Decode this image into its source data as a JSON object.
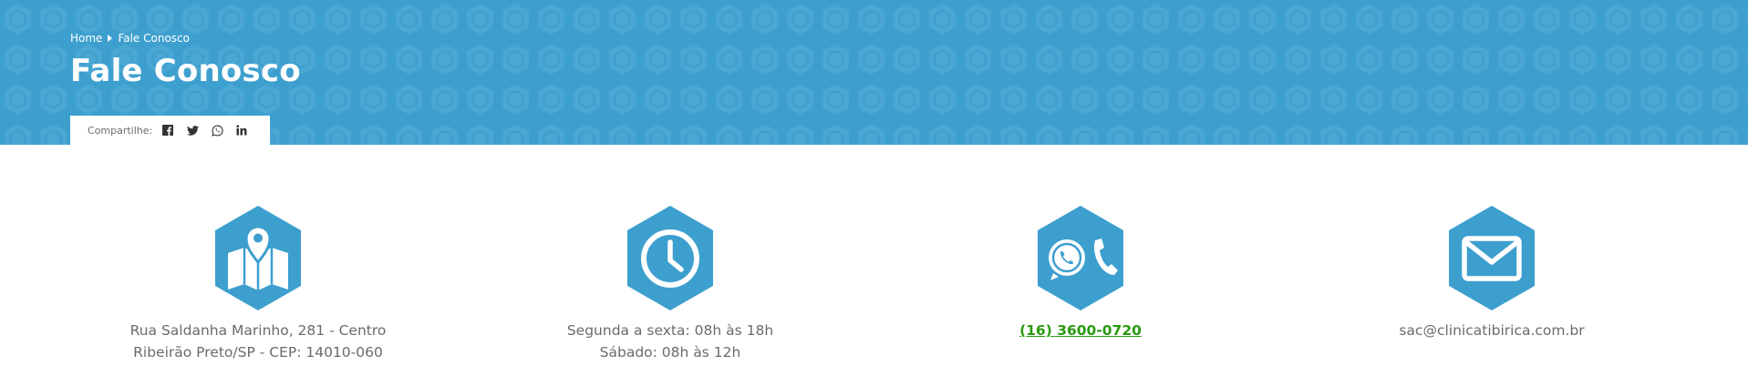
{
  "breadcrumb": {
    "home": "Home",
    "current": "Fale Conosco"
  },
  "page": {
    "title": "Fale Conosco"
  },
  "share": {
    "label": "Compartilhe:",
    "networks": [
      "facebook-icon",
      "twitter-icon",
      "whatsapp-icon",
      "linkedin-icon"
    ]
  },
  "contacts": {
    "address": {
      "icon": "map-pin-icon",
      "line1": "Rua Saldanha Marinho, 281 - Centro",
      "line2": "Ribeirão Preto/SP - CEP: 14010-060"
    },
    "hours": {
      "icon": "clock-icon",
      "line1": "Segunda a sexta: 08h às 18h",
      "line2": "Sábado: 08h às 12h"
    },
    "phone": {
      "icon": "whatsapp-phone-icon",
      "number": "(16) 3600-0720"
    },
    "email": {
      "icon": "envelope-icon",
      "address": "sac@clinicatibirica.com.br"
    }
  },
  "colors": {
    "banner": "#3d9fce",
    "icon_hex": "#3d9fce",
    "text": "#6b6b6b",
    "phone_link": "#2a9a12"
  }
}
